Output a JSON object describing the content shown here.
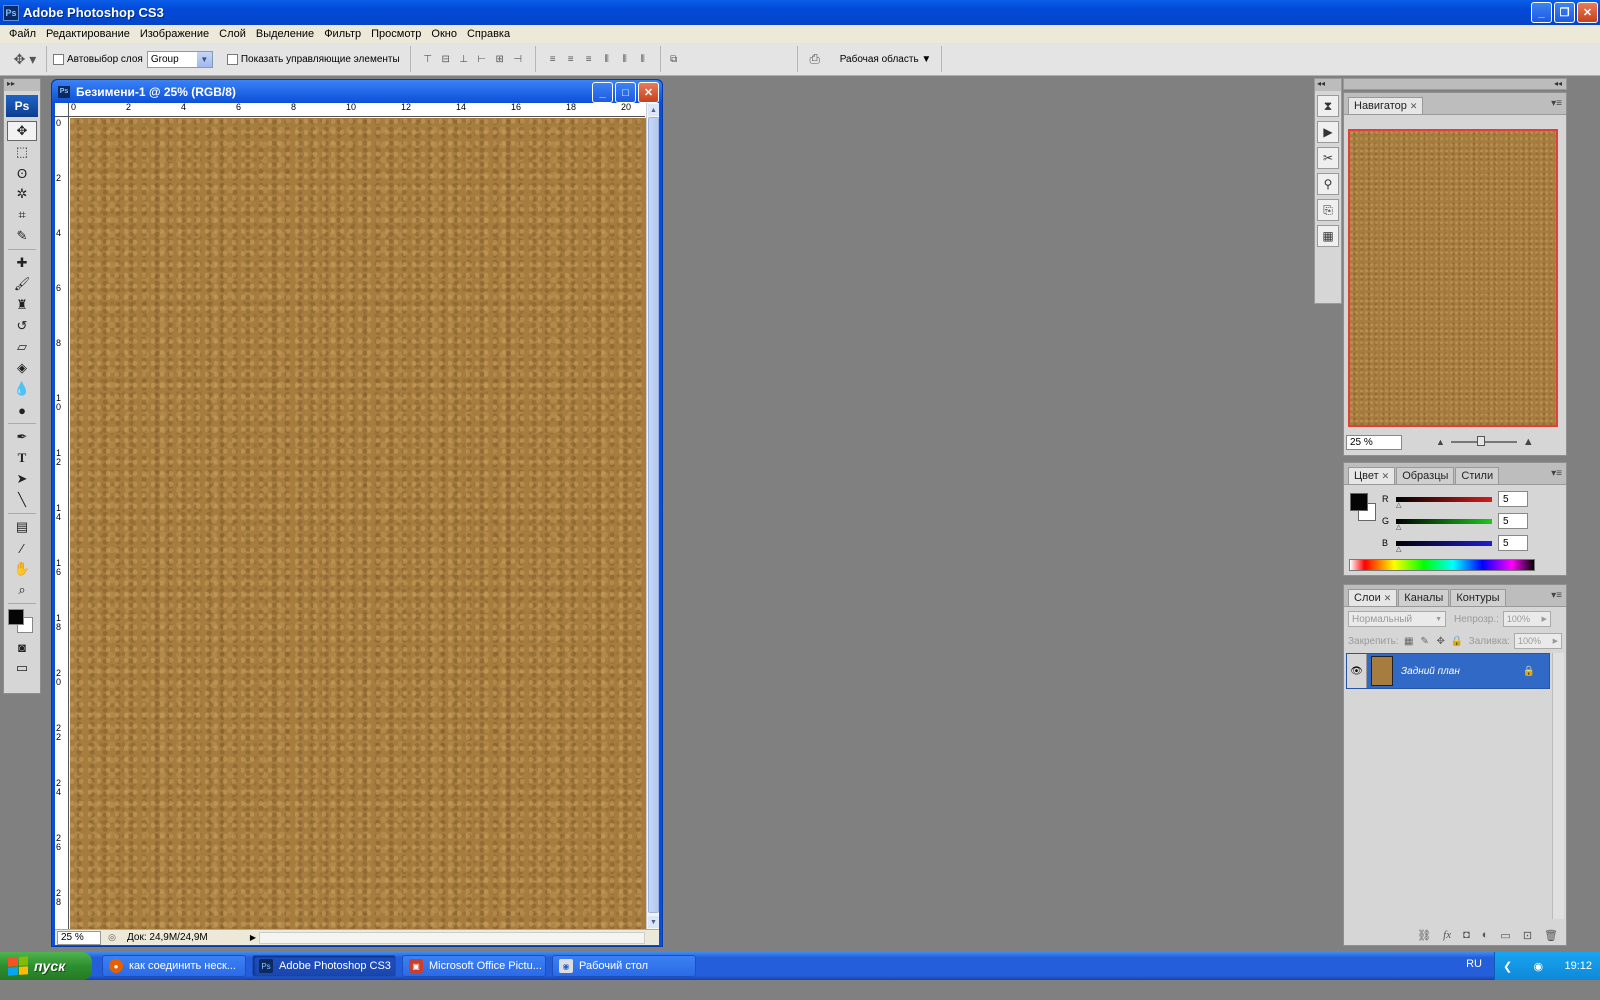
{
  "window": {
    "title": "Adobe Photoshop CS3",
    "app_badge": "Ps"
  },
  "menu": [
    "Файл",
    "Редактирование",
    "Изображение",
    "Слой",
    "Выделение",
    "Фильтр",
    "Просмотр",
    "Окно",
    "Справка"
  ],
  "options": {
    "auto_select_label": "Автовыбор слоя",
    "auto_select_value": "Group",
    "show_controls_label": "Показать управляющие элементы",
    "workspace_label": "Рабочая область"
  },
  "tools": {
    "logo": "Ps",
    "icons": [
      "move-tool",
      "marquee-tool",
      "lasso-tool",
      "magic-wand-tool",
      "crop-tool",
      "slice-tool",
      "healing-brush-tool",
      "brush-tool",
      "clone-stamp-tool",
      "history-brush-tool",
      "eraser-tool",
      "paint-bucket-tool",
      "blur-tool",
      "dodge-tool",
      "pen-tool",
      "type-tool",
      "path-selection-tool",
      "line-tool",
      "notes-tool",
      "eyedropper-tool",
      "hand-tool",
      "zoom-tool"
    ],
    "foreground_color": "#050505",
    "background_color": "#ffffff"
  },
  "document": {
    "title": "Безимени-1 @ 25% (RGB/8)",
    "zoom": "25 %",
    "doc_info": "Док: 24,9M/24,9M",
    "ruler_h": [
      "0",
      "2",
      "4",
      "6",
      "8",
      "10",
      "12",
      "14",
      "16",
      "18",
      "20"
    ],
    "ruler_v": [
      "0",
      "2",
      "4",
      "6",
      "8",
      "10",
      "12",
      "14",
      "16",
      "18",
      "20",
      "22",
      "24",
      "26",
      "28"
    ],
    "texture_color": "#a77d3f"
  },
  "navigator": {
    "tab": "Навигатор",
    "zoom": "25 %"
  },
  "color_panel": {
    "tabs": [
      "Цвет",
      "Образцы",
      "Стили"
    ],
    "channels": [
      {
        "label": "R",
        "value": "5",
        "gradient": "#d21e1e"
      },
      {
        "label": "G",
        "value": "5",
        "gradient": "#1ec81e"
      },
      {
        "label": "B",
        "value": "5",
        "gradient": "#1e1ed2"
      }
    ]
  },
  "layers_panel": {
    "tabs": [
      "Слои",
      "Каналы",
      "Контуры"
    ],
    "blend_mode": "Нормальный",
    "opacity_label": "Непрозр.:",
    "opacity_value": "100%",
    "lock_label": "Закрепить:",
    "fill_label": "Заливка:",
    "fill_value": "100%",
    "layers": [
      {
        "name": "Задний план"
      }
    ]
  },
  "taskbar": {
    "start": "пуск",
    "tasks": [
      {
        "label": "как соединить неск...",
        "icon": "firefox-icon"
      },
      {
        "label": "Adobe Photoshop CS3",
        "icon": "photoshop-icon"
      },
      {
        "label": "Microsoft Office Pictu...",
        "icon": "office-picture-icon"
      },
      {
        "label": "Рабочий стол",
        "icon": "desktop-icon"
      }
    ],
    "lang": "RU",
    "time": "19:12"
  }
}
